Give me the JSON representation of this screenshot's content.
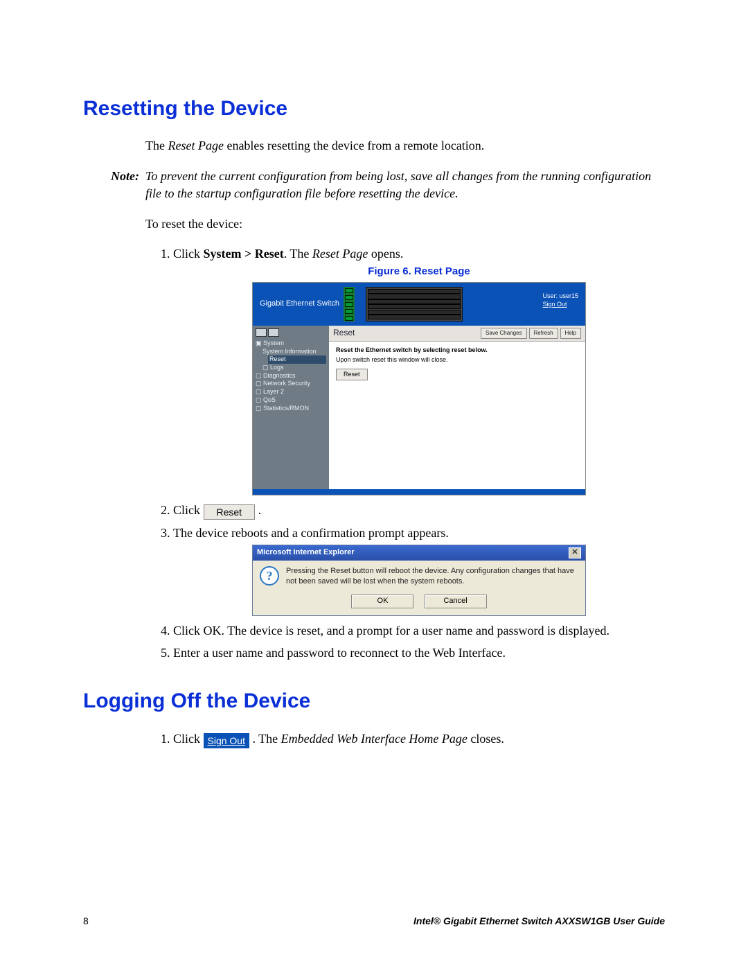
{
  "section1": {
    "title": "Resetting the Device",
    "intro_pre": "The ",
    "intro_em": "Reset Page",
    "intro_post": " enables resetting the device from a remote location.",
    "note_label": "Note:",
    "note_body": "To prevent the current configuration from being lost, save all changes from the running configuration file to the startup configuration file before resetting the device.",
    "lead": "To reset the device:",
    "step1_a": "Click ",
    "step1_b": "System > Reset",
    "step1_c": ". The ",
    "step1_d": "Reset Page",
    "step1_e": " opens.",
    "figure_caption": "Figure 6. Reset Page",
    "step2": "Click ",
    "step2_btn": "Reset",
    "step2_end": ".",
    "step3": "The device reboots and a confirmation prompt appears.",
    "step4": "Click OK. The device is reset, and a prompt for a user name and password is displayed.",
    "step5": "Enter a user name and password to reconnect to the Web Interface."
  },
  "figure6": {
    "brand": "Gigabit Ethernet Switch",
    "user_label": "User: user15",
    "signout": "Sign Out",
    "nav": {
      "system": "System",
      "system_info": "System Information",
      "reset": "Reset",
      "logs": "Logs",
      "diagnostics": "Diagnostics",
      "network_security": "Network Security",
      "layer2": "Layer 2",
      "qos": "QoS",
      "stats": "Statistics/RMON"
    },
    "panel_title": "Reset",
    "btn_save": "Save Changes",
    "btn_refresh": "Refresh",
    "btn_help": "Help",
    "line1": "Reset the Ethernet switch by selecting reset below.",
    "line2": "Upon switch reset this window will close.",
    "btn_reset": "Reset"
  },
  "dialog": {
    "title": "Microsoft Internet Explorer",
    "message": "Pressing the Reset button will reboot the device. Any configuration changes that have not been saved will be lost when the system reboots.",
    "ok": "OK",
    "cancel": "Cancel",
    "close_glyph": "✕"
  },
  "section2": {
    "title": "Logging Off the Device",
    "step1_a": "Click ",
    "signout_btn": "Sign Out",
    "step1_b": ". The ",
    "step1_c": "Embedded Web Interface Home Page",
    "step1_d": " closes."
  },
  "footer": {
    "page_number": "8",
    "guide": "Intel® Gigabit Ethernet Switch AXXSW1GB User Guide"
  }
}
